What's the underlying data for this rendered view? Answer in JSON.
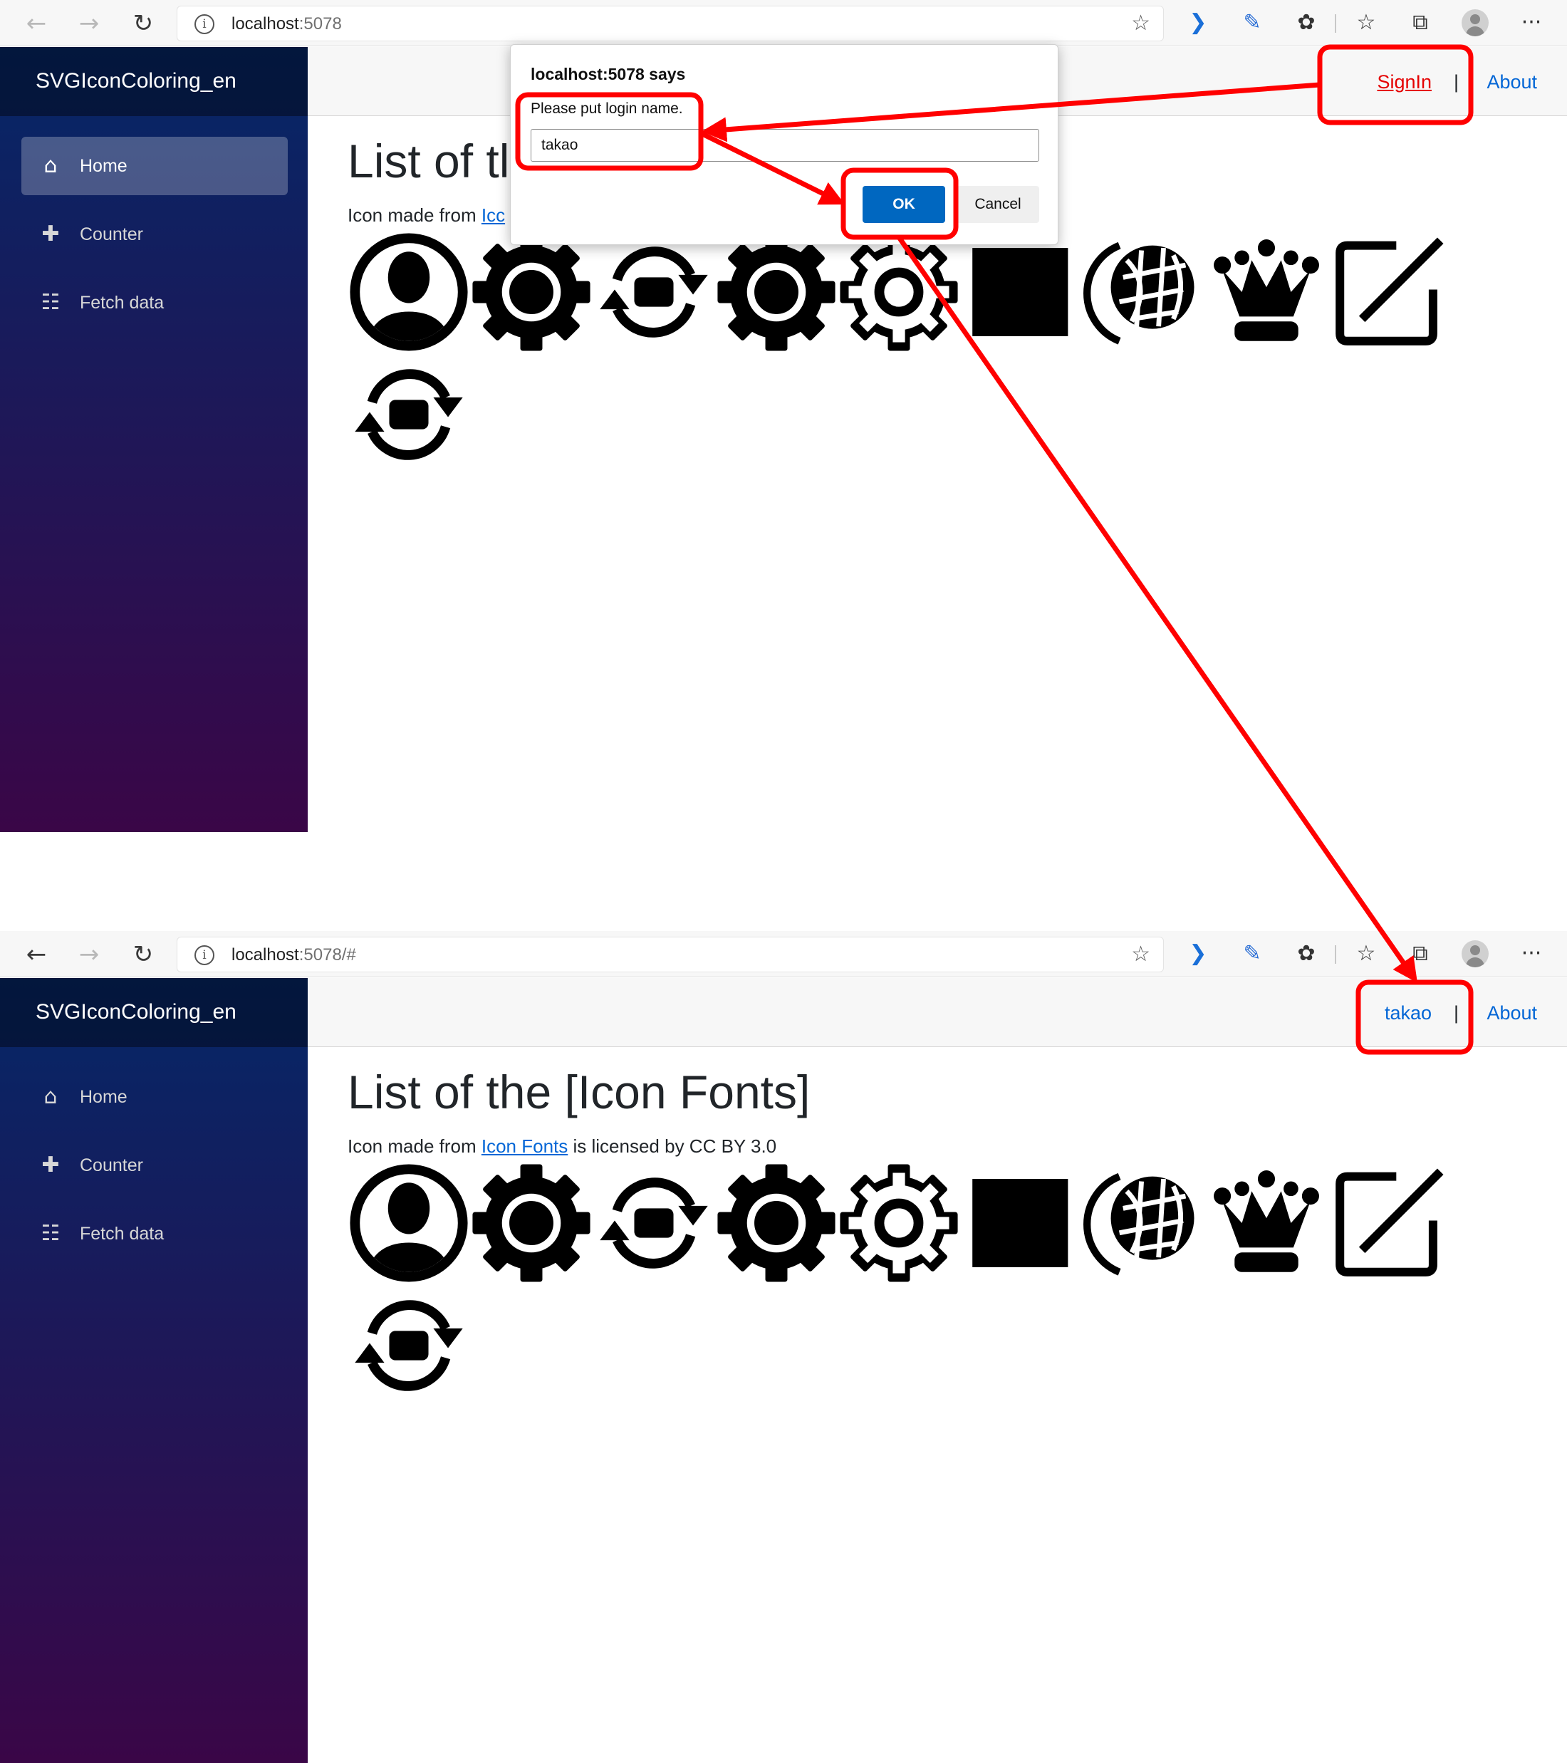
{
  "browser": {
    "nav_back": "←",
    "nav_forward": "→",
    "nav_reload": "↻",
    "tab_1": {
      "url_host": "localhost",
      "url_rest": ":5078"
    },
    "tab_2": {
      "url_host": "localhost",
      "url_rest": ":5078/#"
    },
    "toolbar_icons": [
      "favorite-add-icon",
      "extension-arrow-icon",
      "pen-icon",
      "puzzle-icon",
      "favorites-icon",
      "collections-icon",
      "profile-avatar-icon",
      "more-menu-icon"
    ],
    "more_menu": "···"
  },
  "app": {
    "brand": "SVGIconColoring_en",
    "nav": [
      {
        "label": "Home",
        "icon": "home-icon"
      },
      {
        "label": "Counter",
        "icon": "plus-icon"
      },
      {
        "label": "Fetch data",
        "icon": "list-icon"
      }
    ],
    "about": "About",
    "separator": "|",
    "page_title_full": "List of the [Icon Fonts]",
    "page_title_clipped": "List of tl",
    "credit_prefix": "Icon made from ",
    "credit_link_full": "Icon Fonts",
    "credit_link_clipped": "Icc",
    "credit_suffix": " is licensed by CC BY 3.0",
    "icons": [
      "user-circle-icon",
      "gear-icon",
      "sync-icon",
      "gear-icon",
      "gear-outline-icon",
      "square-icon",
      "globe-icon",
      "crown-icon",
      "edit-icon",
      "sync-icon"
    ]
  },
  "before": {
    "login_link": "SignIn",
    "dialog": {
      "title": "localhost:5078 says",
      "message": "Please put login name.",
      "input_value": "takao",
      "ok": "OK",
      "cancel": "Cancel"
    }
  },
  "after": {
    "login_link": "takao"
  },
  "annotation": {
    "color": "#ff0000"
  },
  "colors": {
    "link": "#0366d6",
    "signin_link": "#e50000",
    "dialog_ok": "#0067c0"
  }
}
